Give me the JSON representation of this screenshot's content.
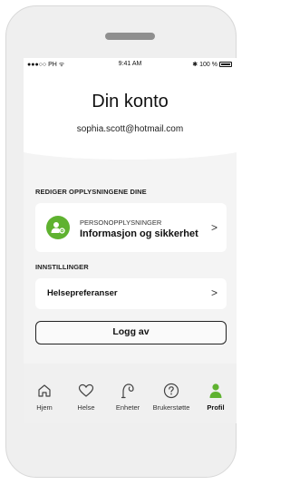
{
  "statusbar": {
    "carrier": "●●●○○ PH ᯤ",
    "time": "9:41 AM",
    "bluetooth": "✱",
    "battery": "100 %"
  },
  "header": {
    "title": "Din konto",
    "email": "sophia.scott@hotmail.com"
  },
  "sections": {
    "edit": "REDIGER OPPLYSNINGENE DINE",
    "settings": "INNSTILLINGER"
  },
  "personal": {
    "small": "PERSONOPPLYSNINGER",
    "big": "Informasjon og sikkerhet",
    "chevron": ">"
  },
  "health": {
    "label": "Helsepreferanser",
    "chevron": ">"
  },
  "logout": "Logg av",
  "tabs": [
    {
      "label": "Hjem",
      "icon": "home-icon"
    },
    {
      "label": "Helse",
      "icon": "heart-icon"
    },
    {
      "label": "Enheter",
      "icon": "hearing-aid-icon"
    },
    {
      "label": "Brukerstøtte",
      "icon": "help-icon"
    },
    {
      "label": "Profil",
      "icon": "profile-icon"
    }
  ],
  "colors": {
    "accent": "#5fb230"
  }
}
